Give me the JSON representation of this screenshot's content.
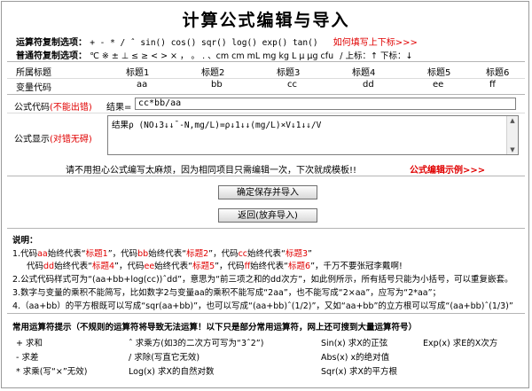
{
  "title": "计算公式编辑与导入",
  "operators": {
    "label": "运算符复制选项：",
    "symbols": "+ - * / ˆ sin() cos() sqr() log() exp() tan()",
    "help_link": "如何填写上下标>>>"
  },
  "common_symbols": {
    "label": "普通符复制选项：",
    "symbols": "℃ ※ ± ⊥ ≤ ≥ < > × ， 。 . 、cm cm mL mg kg L μ μg cfu",
    "sub_sup": "/ 上标：↑   下标：↓"
  },
  "grid": {
    "header_label": "所属标题",
    "code_label": "变量代码",
    "titles": [
      "标题1",
      "标题2",
      "标题3",
      "标题4",
      "标题5",
      "标题6"
    ],
    "codes": [
      "aa",
      "bb",
      "cc",
      "dd",
      "ee",
      "ff"
    ]
  },
  "formula_code": {
    "label": "公式代码",
    "label_hint": "(不能出错)",
    "result_label": "结果=",
    "value": "cc*bb/aa"
  },
  "formula_display": {
    "label": "公式显示",
    "label_hint": "(对错无碍)",
    "value": "结果ρ (NO↓3↓↓ˉ-N,mg/L)=ρ↓1↓↓(mg/L)×V↓1↓↓/V"
  },
  "tip": {
    "text": "请不用担心公式编写太麻烦，因为相同项目只需编辑一次，下次就成模板!!",
    "link": "公式编辑示例>>>"
  },
  "buttons": {
    "save": "确定保存并导入",
    "back": "返回(放弃导入)"
  },
  "notes": {
    "heading": "说明：",
    "line1": [
      {
        "t": "1.代码",
        "c": ""
      },
      {
        "t": "aa",
        "c": "red"
      },
      {
        "t": "始终代表“",
        "c": ""
      },
      {
        "t": "标题1",
        "c": "red"
      },
      {
        "t": "”，代码",
        "c": ""
      },
      {
        "t": "bb",
        "c": "red"
      },
      {
        "t": "始终代表“",
        "c": ""
      },
      {
        "t": "标题2",
        "c": "red"
      },
      {
        "t": "”，代码",
        "c": ""
      },
      {
        "t": "cc",
        "c": "red"
      },
      {
        "t": "始终代表“",
        "c": ""
      },
      {
        "t": "标题3",
        "c": "red"
      },
      {
        "t": "”",
        "c": ""
      }
    ],
    "line2": [
      {
        "t": "代码",
        "c": ""
      },
      {
        "t": "dd",
        "c": "red"
      },
      {
        "t": "始终代表“",
        "c": ""
      },
      {
        "t": "标题4",
        "c": "red"
      },
      {
        "t": "”，代码",
        "c": ""
      },
      {
        "t": "ee",
        "c": "red"
      },
      {
        "t": "始终代表“",
        "c": ""
      },
      {
        "t": "标题5",
        "c": "red"
      },
      {
        "t": "”，代码",
        "c": ""
      },
      {
        "t": "ff",
        "c": "red"
      },
      {
        "t": "始终代表“",
        "c": ""
      },
      {
        "t": "标题6",
        "c": "red"
      },
      {
        "t": "”，千万不要张冠李戴啊!",
        "c": ""
      }
    ],
    "line3": "2.公式代码样式可为“(aa+bb+log(cc))ˆdd”，意思为“前三项之和的dd次方”，如此例所示，所有括号只能为小括号，可以重复嵌套。",
    "line4": "3.数字与变量的乘积不能简写，比如数字2与变量aa的乘积不能写成“2aa”，也不能写成“2×aa”，应写为“2*aa”；",
    "line5": "4.（aa+bb）的平方根既可以写成“sqr(aa+bb)”，也可以写成“(aa+bb)ˆ(1/2)”，又如“aa+bb”的立方根可以写成“(aa+bb)ˆ(1/3)”"
  },
  "common_ops": {
    "heading": "常用运算符提示（不规则的运算符将导致无法运算！以下只是部分常用运算符，网上还可搜到大量运算符号）",
    "items": [
      "+ 求和",
      "ˆ 求乘方(如3的二次方可写为“3ˆ2”)",
      "Sin(x) 求X的正弦",
      "Exp(x) 求E的X次方",
      "- 求差",
      "/ 求除(写直它无效)",
      "Abs(x) x的绝对值",
      "* 求乘(写“×”无效)",
      "Log(x) 求X的自然对数",
      "Sqr(x) 求X的平方根"
    ]
  }
}
